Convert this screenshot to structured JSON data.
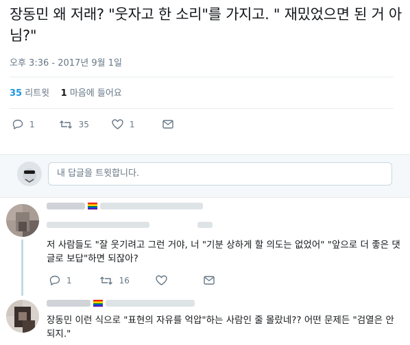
{
  "tweet": {
    "text": "장동민 왜 저래? \"웃자고 한 소리\"를 가지고. \" 재밌었으면 된 거 아님?\"",
    "timestamp": "오후 3:36 - 2017년 9월 1일"
  },
  "stats": {
    "retweet_count": "35",
    "retweet_label": "리트윗",
    "like_count": "1",
    "like_label": "마음에 들어요"
  },
  "actions": {
    "reply_count": "1",
    "retweet_count": "35",
    "like_count": "1"
  },
  "reply_box": {
    "placeholder": "내 답글을 트윗합니다."
  },
  "replies": [
    {
      "name": "",
      "text": "저 사람들도 \"잘 웃기려고 그런 거야, 너 \"기분 상하게 할 의도는 없었어\" \"앞으로 더 좋은 댓글로 보답\"하면 되잖아?",
      "reply_count": "1",
      "retweet_count": "16"
    },
    {
      "name": "",
      "text": "장동민 이런 식으로 \"표현의 자유를 억압\"하는 사람인 줄 몰랐네?? 어떤 문제든 \"검열은 안 되지.\""
    }
  ],
  "colors": {
    "accent": "#1b95e0",
    "muted": "#657786",
    "text": "#14171a"
  }
}
